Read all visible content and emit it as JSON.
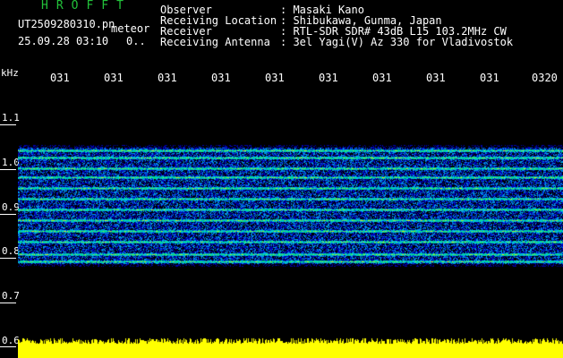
{
  "app": {
    "title": "HROFFT"
  },
  "file": {
    "name": "UT2509280310.pn",
    "kind": "meteor",
    "timestamp": "25.09.28 03:10",
    "extra": "0.."
  },
  "header": [
    {
      "label": "Observer",
      "value": ": Masaki Kano"
    },
    {
      "label": "Receiving Location",
      "value": ": Shibukawa, Gunma, Japan"
    },
    {
      "label": "Receiver",
      "value": ": RTL-SDR SDR# 43dB L15 103.2MHz CW"
    },
    {
      "label": "Receiving Antenna",
      "value": ": 3el Yagi(V) Az 330 for Vladivostok"
    }
  ],
  "axis": {
    "unit": "kHz",
    "x_ticks": [
      "031",
      "031",
      "031",
      "031",
      "031",
      "031",
      "031",
      "031",
      "031",
      "0320"
    ],
    "y_ticks": [
      "1.1",
      "1.0",
      "0.9",
      "0.8",
      "0.7",
      "0.6"
    ]
  },
  "colors": {
    "title": "#22c23a",
    "bottom_band": "#ffff00",
    "background": "#000000"
  }
}
